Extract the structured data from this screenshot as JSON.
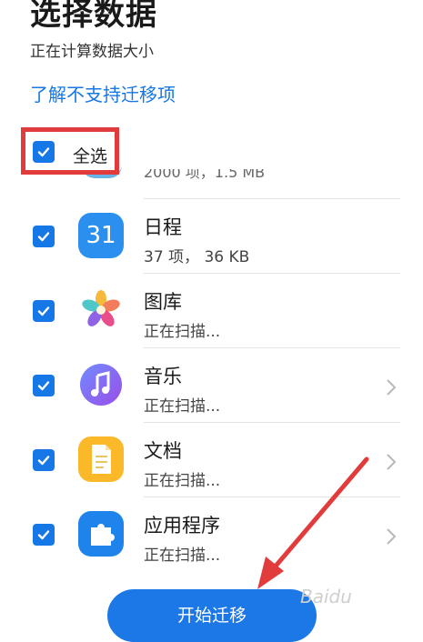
{
  "header": {
    "title": "选择数据",
    "subtitle": "正在计算数据大小",
    "unsupported_link": "了解不支持迁移项"
  },
  "select_all": {
    "label": "全选",
    "checked": true
  },
  "partial_row": {
    "status": "2000 项，1.5 MB"
  },
  "items": [
    {
      "name": "日程",
      "status": "37 项，  36 KB",
      "icon": "calendar-icon",
      "icon_text": "31",
      "checked": true,
      "has_chevron": false
    },
    {
      "name": "图库",
      "status": "正在扫描...",
      "icon": "gallery-icon",
      "checked": true,
      "has_chevron": false
    },
    {
      "name": "音乐",
      "status": "正在扫描...",
      "icon": "music-icon",
      "checked": true,
      "has_chevron": true
    },
    {
      "name": "文档",
      "status": "正在扫描...",
      "icon": "document-icon",
      "checked": true,
      "has_chevron": true
    },
    {
      "name": "应用程序",
      "status": "正在扫描...",
      "icon": "apps-icon",
      "checked": true,
      "has_chevron": true
    }
  ],
  "footer": {
    "start_button": "开始迁移"
  },
  "watermark": "Baidu",
  "colors": {
    "accent": "#1677e6",
    "highlight_box": "#e23b3b",
    "annotation_arrow": "#e23b3b"
  }
}
